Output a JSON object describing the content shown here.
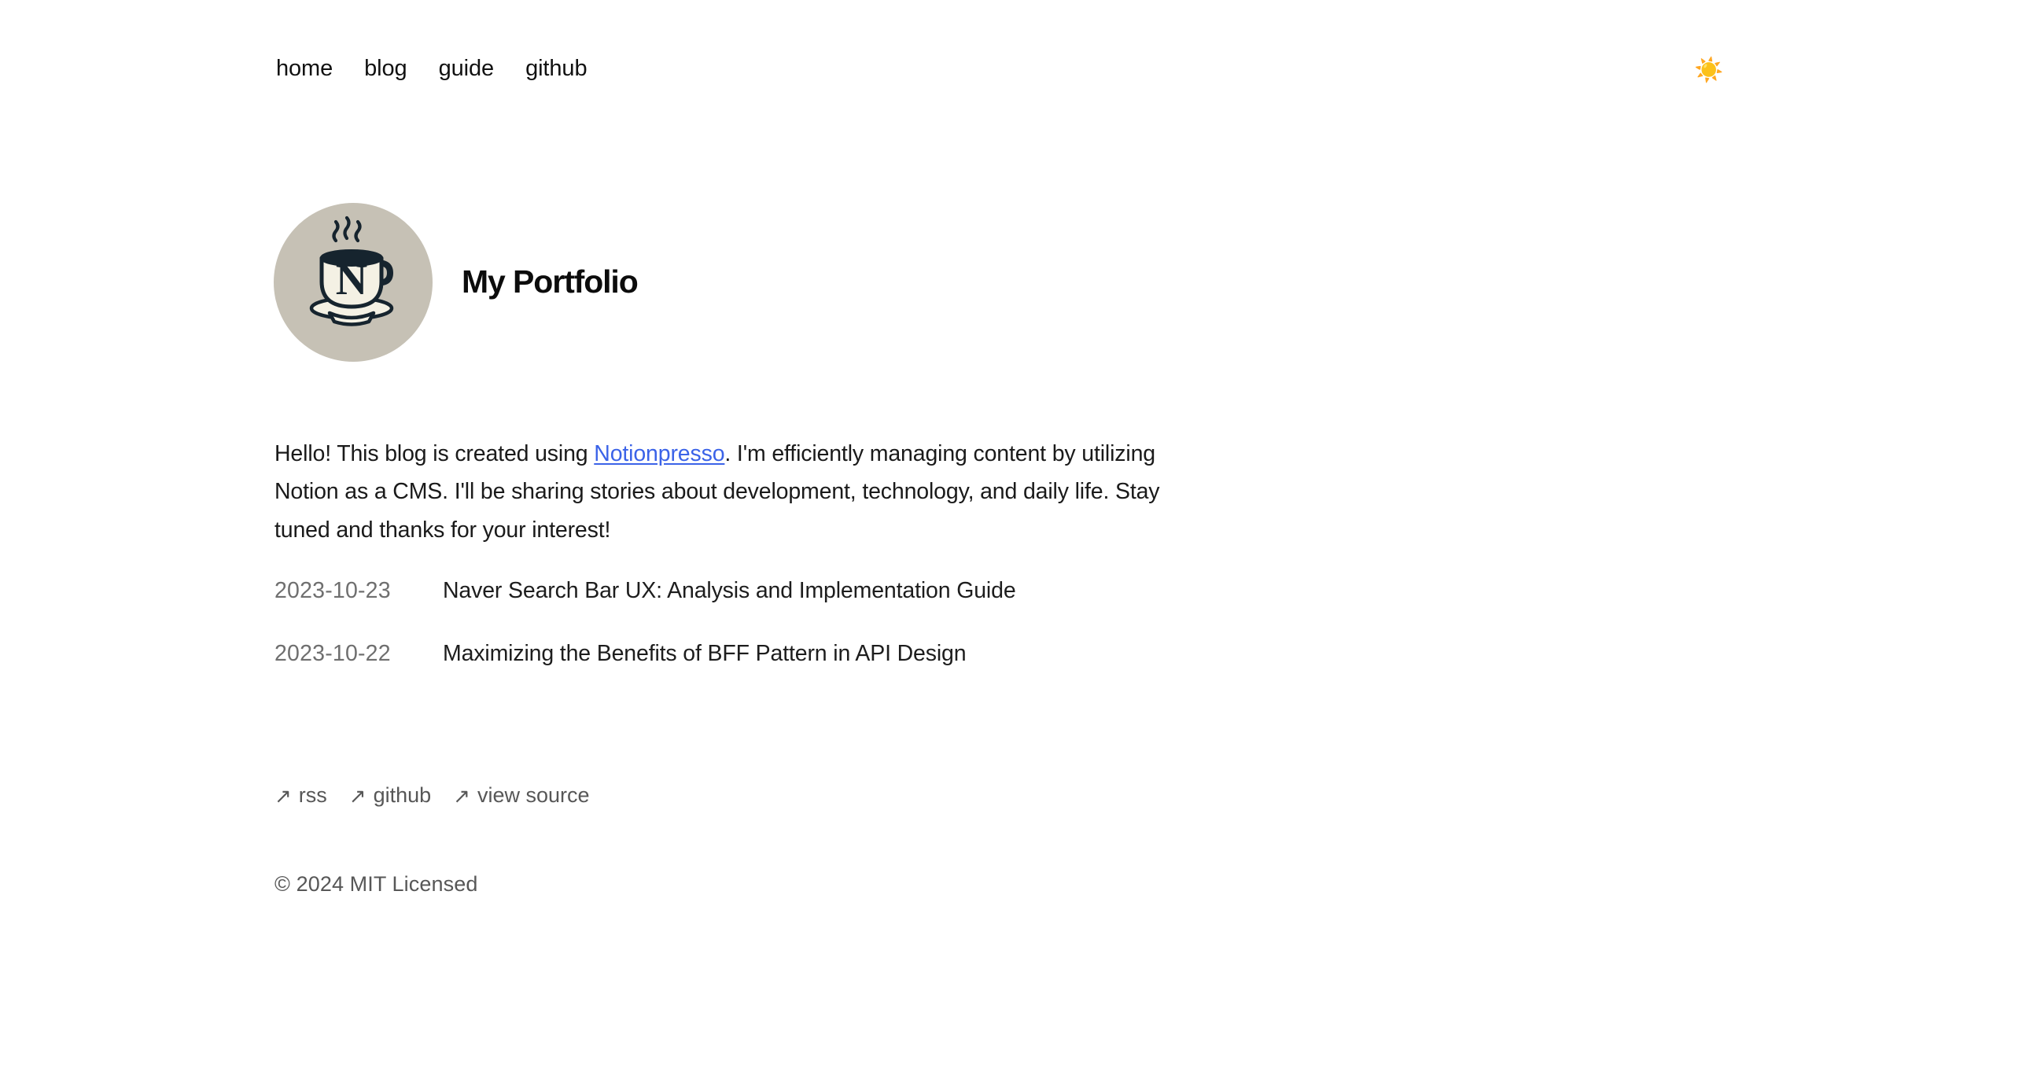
{
  "site": {
    "title": "My Portfolio",
    "avatar_icon": "coffee-cup-n-logo",
    "avatar_bg_color": "#c6c1b5"
  },
  "nav": {
    "items": [
      {
        "label": "home"
      },
      {
        "label": "blog"
      },
      {
        "label": "guide"
      },
      {
        "label": "github"
      }
    ],
    "theme_toggle_icon": "sun-icon",
    "theme_toggle_glyph": "☀️"
  },
  "intro": {
    "before_link": "Hello! This blog is created using ",
    "link_label": "Notionpresso",
    "after_link": ". I'm efficiently managing content by utilizing Notion as a CMS. I'll be sharing stories about development, technology, and daily life. Stay tuned and thanks for your interest!",
    "link_color": "#3b63e8"
  },
  "posts": [
    {
      "date": "2023-10-23",
      "title": "Naver Search Bar UX: Analysis and Implementation Guide"
    },
    {
      "date": "2023-10-22",
      "title": "Maximizing the Benefits of BFF Pattern in API Design"
    }
  ],
  "footer": {
    "arrow_glyph": "↗",
    "links": [
      {
        "label": "rss",
        "icon": "external-link-arrow-icon"
      },
      {
        "label": "github",
        "icon": "external-link-arrow-icon"
      },
      {
        "label": "view source",
        "icon": "external-link-arrow-icon"
      }
    ],
    "copyright": "© 2024 MIT Licensed"
  }
}
